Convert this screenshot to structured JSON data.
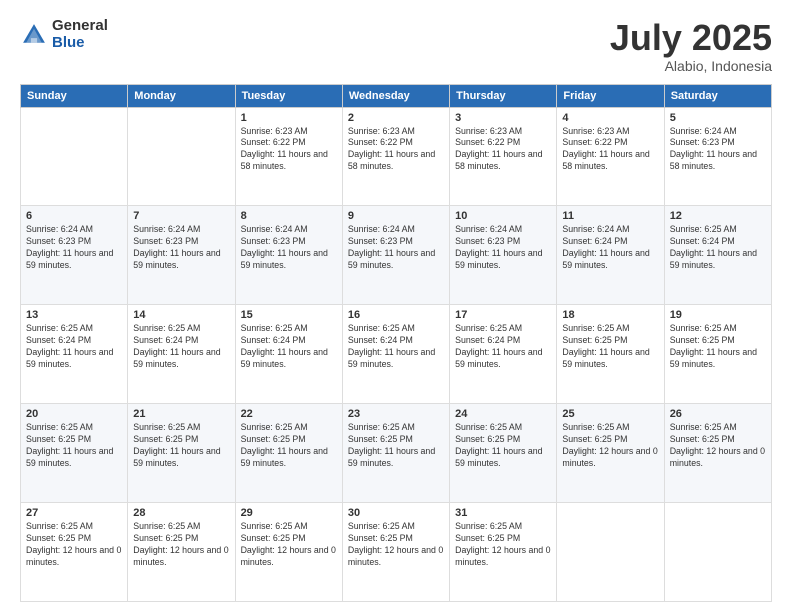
{
  "logo": {
    "general": "General",
    "blue": "Blue"
  },
  "title": "July 2025",
  "location": "Alabio, Indonesia",
  "days_header": [
    "Sunday",
    "Monday",
    "Tuesday",
    "Wednesday",
    "Thursday",
    "Friday",
    "Saturday"
  ],
  "weeks": [
    [
      {
        "day": "",
        "info": ""
      },
      {
        "day": "",
        "info": ""
      },
      {
        "day": "1",
        "info": "Sunrise: 6:23 AM\nSunset: 6:22 PM\nDaylight: 11 hours and 58 minutes."
      },
      {
        "day": "2",
        "info": "Sunrise: 6:23 AM\nSunset: 6:22 PM\nDaylight: 11 hours and 58 minutes."
      },
      {
        "day": "3",
        "info": "Sunrise: 6:23 AM\nSunset: 6:22 PM\nDaylight: 11 hours and 58 minutes."
      },
      {
        "day": "4",
        "info": "Sunrise: 6:23 AM\nSunset: 6:22 PM\nDaylight: 11 hours and 58 minutes."
      },
      {
        "day": "5",
        "info": "Sunrise: 6:24 AM\nSunset: 6:23 PM\nDaylight: 11 hours and 58 minutes."
      }
    ],
    [
      {
        "day": "6",
        "info": "Sunrise: 6:24 AM\nSunset: 6:23 PM\nDaylight: 11 hours and 59 minutes."
      },
      {
        "day": "7",
        "info": "Sunrise: 6:24 AM\nSunset: 6:23 PM\nDaylight: 11 hours and 59 minutes."
      },
      {
        "day": "8",
        "info": "Sunrise: 6:24 AM\nSunset: 6:23 PM\nDaylight: 11 hours and 59 minutes."
      },
      {
        "day": "9",
        "info": "Sunrise: 6:24 AM\nSunset: 6:23 PM\nDaylight: 11 hours and 59 minutes."
      },
      {
        "day": "10",
        "info": "Sunrise: 6:24 AM\nSunset: 6:23 PM\nDaylight: 11 hours and 59 minutes."
      },
      {
        "day": "11",
        "info": "Sunrise: 6:24 AM\nSunset: 6:24 PM\nDaylight: 11 hours and 59 minutes."
      },
      {
        "day": "12",
        "info": "Sunrise: 6:25 AM\nSunset: 6:24 PM\nDaylight: 11 hours and 59 minutes."
      }
    ],
    [
      {
        "day": "13",
        "info": "Sunrise: 6:25 AM\nSunset: 6:24 PM\nDaylight: 11 hours and 59 minutes."
      },
      {
        "day": "14",
        "info": "Sunrise: 6:25 AM\nSunset: 6:24 PM\nDaylight: 11 hours and 59 minutes."
      },
      {
        "day": "15",
        "info": "Sunrise: 6:25 AM\nSunset: 6:24 PM\nDaylight: 11 hours and 59 minutes."
      },
      {
        "day": "16",
        "info": "Sunrise: 6:25 AM\nSunset: 6:24 PM\nDaylight: 11 hours and 59 minutes."
      },
      {
        "day": "17",
        "info": "Sunrise: 6:25 AM\nSunset: 6:24 PM\nDaylight: 11 hours and 59 minutes."
      },
      {
        "day": "18",
        "info": "Sunrise: 6:25 AM\nSunset: 6:25 PM\nDaylight: 11 hours and 59 minutes."
      },
      {
        "day": "19",
        "info": "Sunrise: 6:25 AM\nSunset: 6:25 PM\nDaylight: 11 hours and 59 minutes."
      }
    ],
    [
      {
        "day": "20",
        "info": "Sunrise: 6:25 AM\nSunset: 6:25 PM\nDaylight: 11 hours and 59 minutes."
      },
      {
        "day": "21",
        "info": "Sunrise: 6:25 AM\nSunset: 6:25 PM\nDaylight: 11 hours and 59 minutes."
      },
      {
        "day": "22",
        "info": "Sunrise: 6:25 AM\nSunset: 6:25 PM\nDaylight: 11 hours and 59 minutes."
      },
      {
        "day": "23",
        "info": "Sunrise: 6:25 AM\nSunset: 6:25 PM\nDaylight: 11 hours and 59 minutes."
      },
      {
        "day": "24",
        "info": "Sunrise: 6:25 AM\nSunset: 6:25 PM\nDaylight: 11 hours and 59 minutes."
      },
      {
        "day": "25",
        "info": "Sunrise: 6:25 AM\nSunset: 6:25 PM\nDaylight: 12 hours and 0 minutes."
      },
      {
        "day": "26",
        "info": "Sunrise: 6:25 AM\nSunset: 6:25 PM\nDaylight: 12 hours and 0 minutes."
      }
    ],
    [
      {
        "day": "27",
        "info": "Sunrise: 6:25 AM\nSunset: 6:25 PM\nDaylight: 12 hours and 0 minutes."
      },
      {
        "day": "28",
        "info": "Sunrise: 6:25 AM\nSunset: 6:25 PM\nDaylight: 12 hours and 0 minutes."
      },
      {
        "day": "29",
        "info": "Sunrise: 6:25 AM\nSunset: 6:25 PM\nDaylight: 12 hours and 0 minutes."
      },
      {
        "day": "30",
        "info": "Sunrise: 6:25 AM\nSunset: 6:25 PM\nDaylight: 12 hours and 0 minutes."
      },
      {
        "day": "31",
        "info": "Sunrise: 6:25 AM\nSunset: 6:25 PM\nDaylight: 12 hours and 0 minutes."
      },
      {
        "day": "",
        "info": ""
      },
      {
        "day": "",
        "info": ""
      }
    ]
  ]
}
